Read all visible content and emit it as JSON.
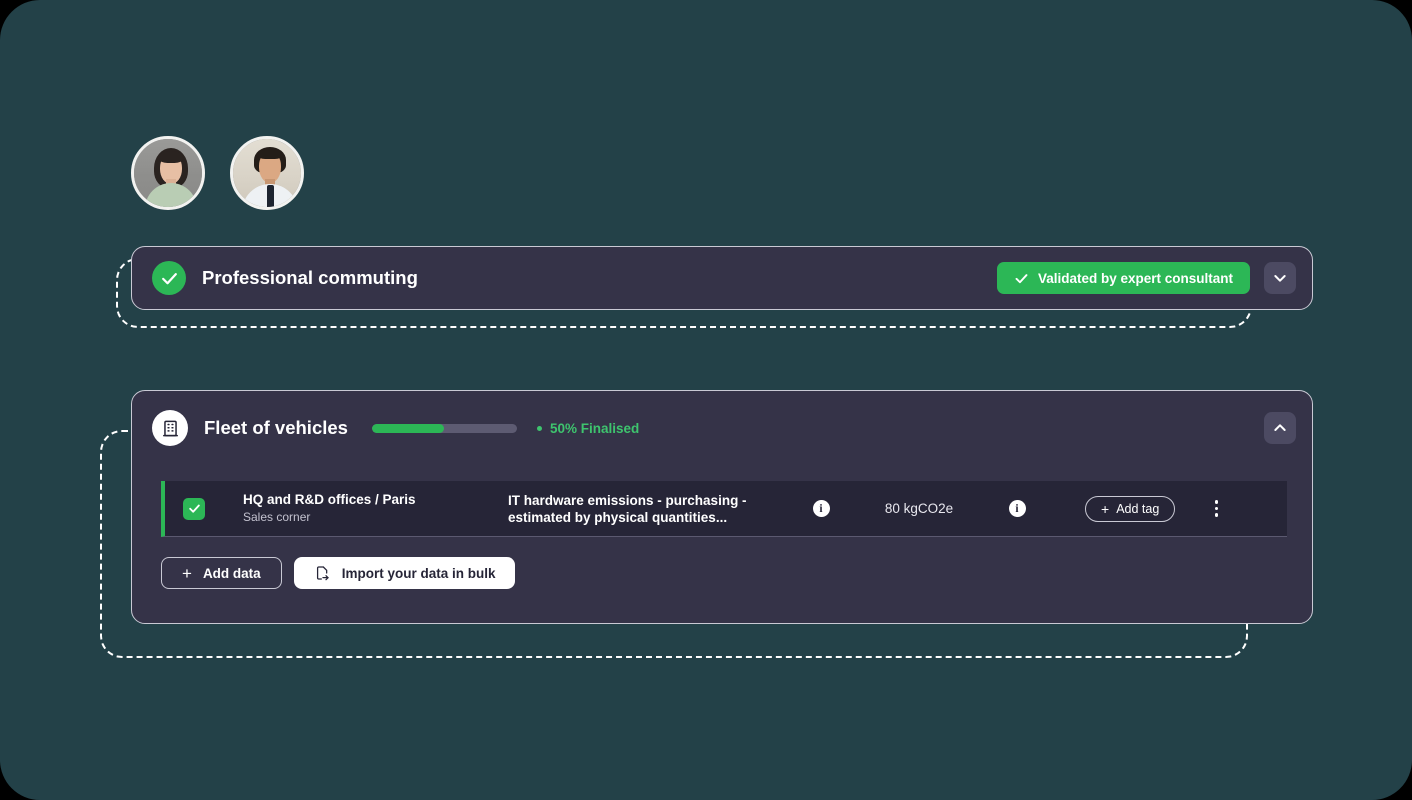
{
  "theme": {
    "background": "#234148",
    "card_bg": "#353348",
    "row_bg": "#262537",
    "accent_green": "#2cb756",
    "label_green": "#3ec46e",
    "border": "#c9c9d4"
  },
  "avatars": [
    {
      "name": "team-member-avatar-1",
      "alt": "Team member portrait 1"
    },
    {
      "name": "team-member-avatar-2",
      "alt": "Team member portrait 2"
    }
  ],
  "commuting_card": {
    "title": "Professional commuting",
    "status_icon": "check-circle-icon",
    "validated_button": {
      "label": "Validated by expert consultant",
      "icon": "check-icon"
    },
    "expand_button": {
      "icon": "chevron-down-icon"
    }
  },
  "fleet_card": {
    "title": "Fleet of vehicles",
    "icon": "building-icon",
    "progress": {
      "percent": 50,
      "label": "50% Finalised"
    },
    "collapse_button": {
      "icon": "chevron-up-icon"
    },
    "table": {
      "rows": [
        {
          "checked": true,
          "site": "HQ and R&D offices / Paris",
          "sub_site": "Sales corner",
          "description": "IT hardware emissions - purchasing - estimated by physical quantities...",
          "info_icon_1": "info-icon",
          "value": "80 kgCO2e",
          "info_icon_2": "info-icon",
          "tag_button": "Add tag",
          "menu_icon": "kebab-menu-icon"
        }
      ]
    },
    "actions": {
      "add_data": "Add data",
      "import_bulk": "Import your data in bulk",
      "import_icon": "file-export-icon"
    }
  }
}
